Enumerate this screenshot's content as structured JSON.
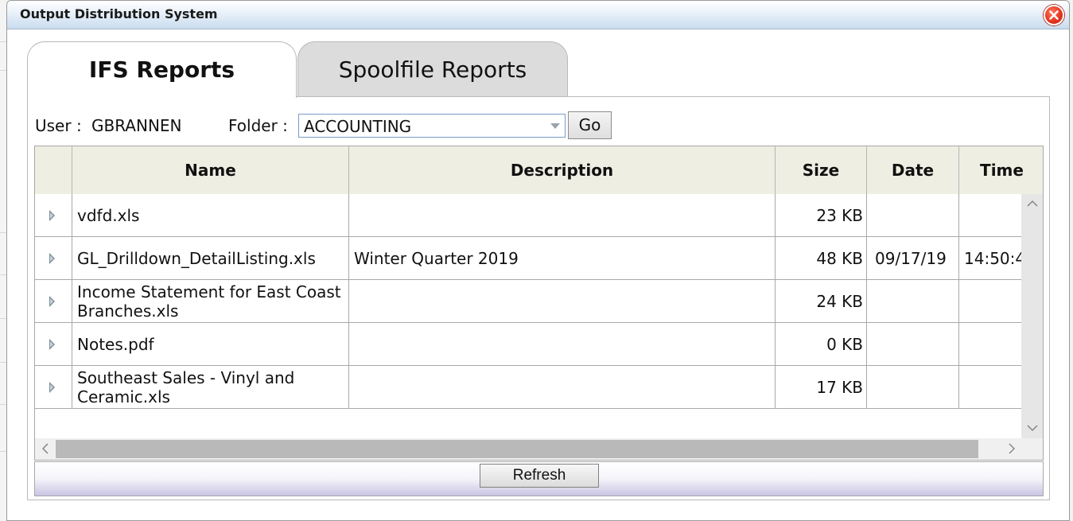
{
  "window": {
    "title": "Output Distribution System"
  },
  "tabs": [
    {
      "label": "IFS Reports",
      "active": true
    },
    {
      "label": "Spoolfile Reports",
      "active": false
    }
  ],
  "toolbar": {
    "user_label": "User :",
    "user_value": "GBRANNEN",
    "folder_label": "Folder :",
    "folder_selected": "ACCOUNTING",
    "go_label": "Go"
  },
  "grid": {
    "columns": [
      "Name",
      "Description",
      "Size",
      "Date",
      "Time"
    ],
    "rows": [
      {
        "name": "vdfd.xls",
        "description": "",
        "size": "23 KB",
        "date": "",
        "time": ""
      },
      {
        "name": "GL_Drilldown_DetailListing.xls",
        "description": "Winter Quarter 2019",
        "size": "48 KB",
        "date": "09/17/19",
        "time": "14:50:4"
      },
      {
        "name": "Income Statement for East Coast Branches.xls",
        "description": "",
        "size": "24 KB",
        "date": "",
        "time": ""
      },
      {
        "name": "Notes.pdf",
        "description": "",
        "size": "0 KB",
        "date": "",
        "time": ""
      },
      {
        "name": "Southeast Sales - Vinyl and Ceramic.xls",
        "description": "",
        "size": "17 KB",
        "date": "",
        "time": ""
      }
    ]
  },
  "footer": {
    "refresh_label": "Refresh"
  },
  "colors": {
    "header_bg": "#efeee2",
    "titlebar_top": "#ffffff",
    "titlebar_bottom": "#c9dcef",
    "close_red": "#e8341f",
    "inactive_tab": "#dcdcdc"
  }
}
